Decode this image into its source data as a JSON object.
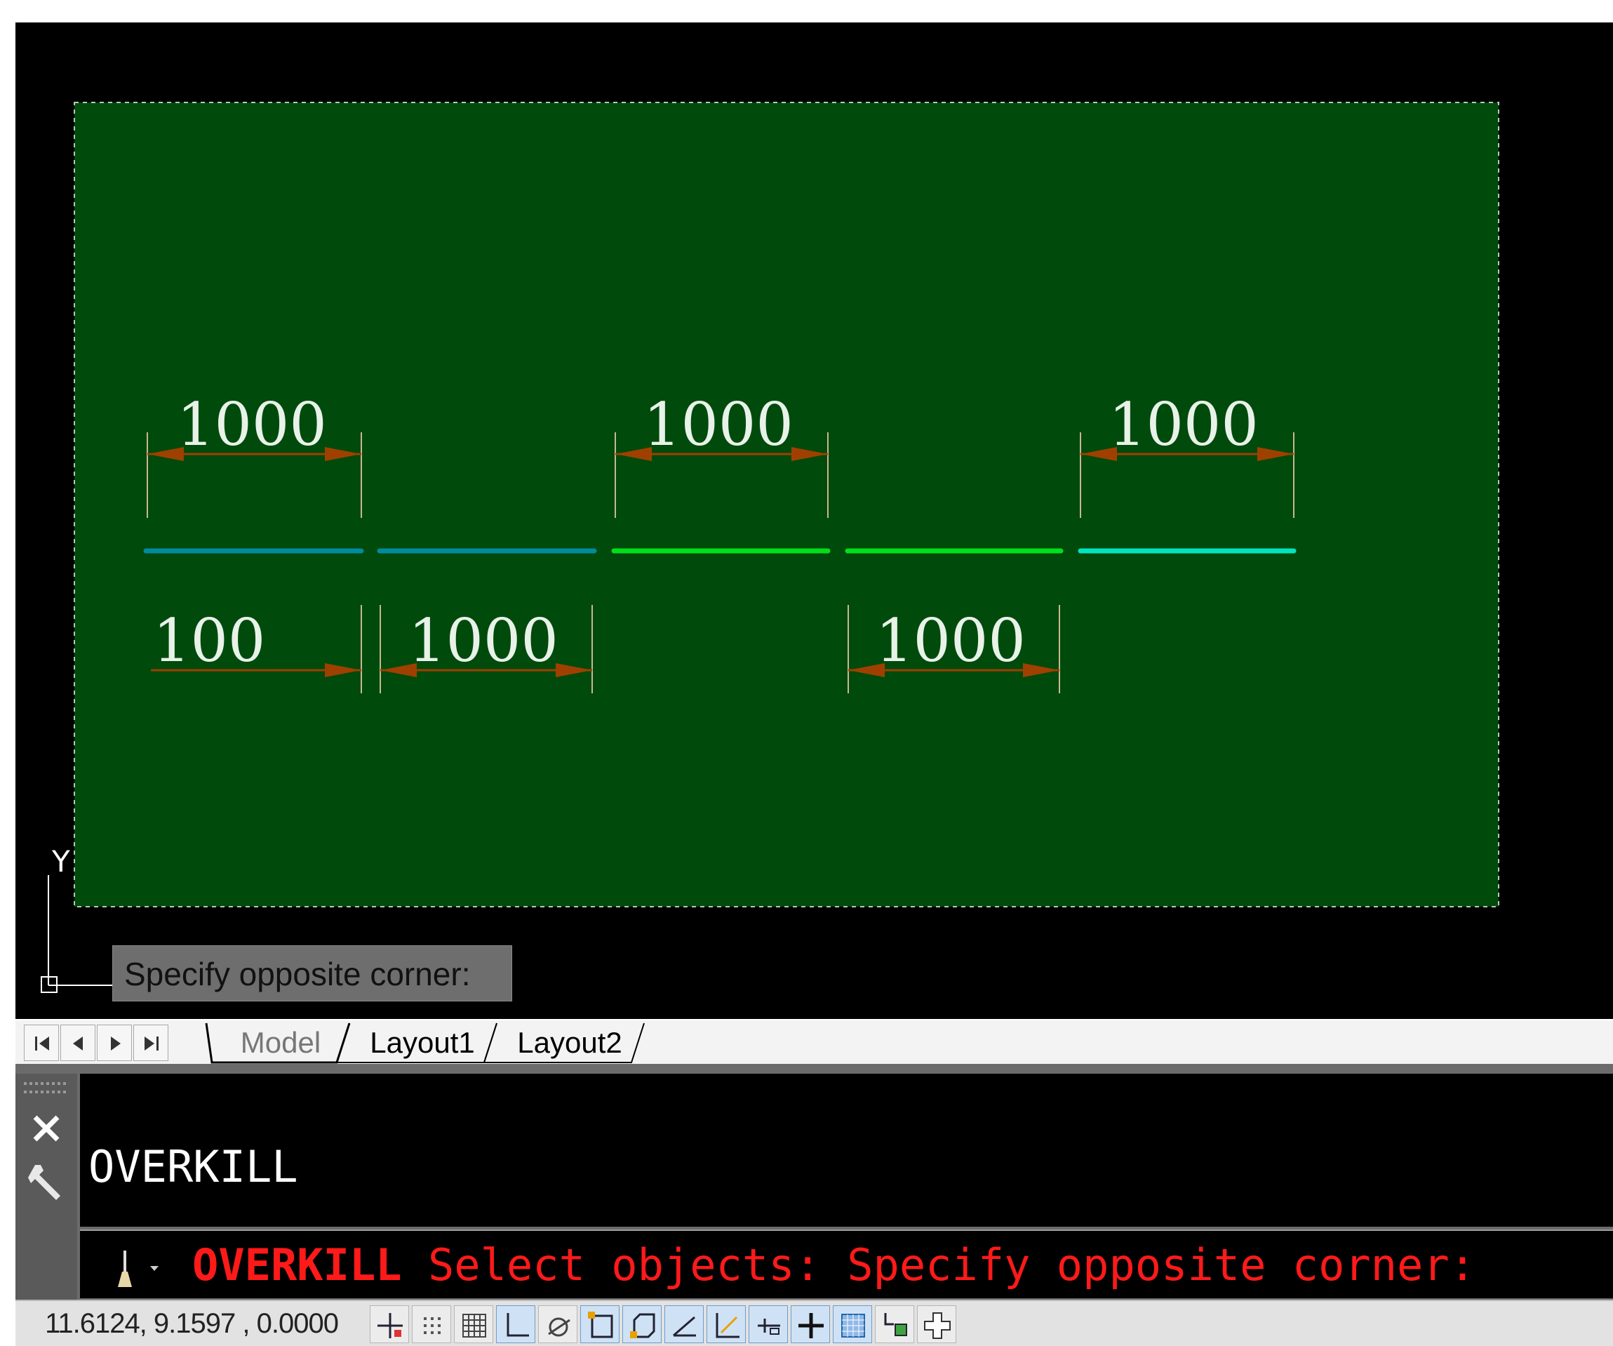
{
  "drawing": {
    "dimensions_top": [
      "1000",
      "1000",
      "1000"
    ],
    "dimensions_bottom": [
      "100",
      "1000",
      "1000"
    ],
    "line_colors": [
      "#008b9e",
      "#008b9e",
      "#00e01a",
      "#00e01a",
      "#00e5c0"
    ],
    "selection_fill": "#004a0c",
    "ucs_axis_label": "Y"
  },
  "tooltip": {
    "text": "Specify opposite corner:"
  },
  "tabs": {
    "model": "Model",
    "layout1": "Layout1",
    "layout2": "Layout2"
  },
  "command": {
    "history": "OVERKILL",
    "prompt_command": "OVERKILL",
    "prompt_rest": "Select objects: Specify opposite corner:",
    "prompt_color": "#ff1a1a"
  },
  "statusbar": {
    "coordinates": "11.6124, 9.1597 , 0.0000",
    "toggles": [
      {
        "name": "infer-constraints",
        "on": false
      },
      {
        "name": "snap-mode",
        "on": false
      },
      {
        "name": "grid-display",
        "on": false
      },
      {
        "name": "ortho-mode",
        "on": true
      },
      {
        "name": "polar-tracking",
        "on": false
      },
      {
        "name": "object-snap",
        "on": true
      },
      {
        "name": "3d-object-snap",
        "on": true
      },
      {
        "name": "object-snap-tracking",
        "on": true
      },
      {
        "name": "dynamic-ucs",
        "on": true
      },
      {
        "name": "dynamic-input",
        "on": true
      },
      {
        "name": "lineweight",
        "on": true
      },
      {
        "name": "transparency",
        "on": true
      },
      {
        "name": "quick-properties",
        "on": false
      },
      {
        "name": "selection-cycling",
        "on": false
      }
    ]
  }
}
